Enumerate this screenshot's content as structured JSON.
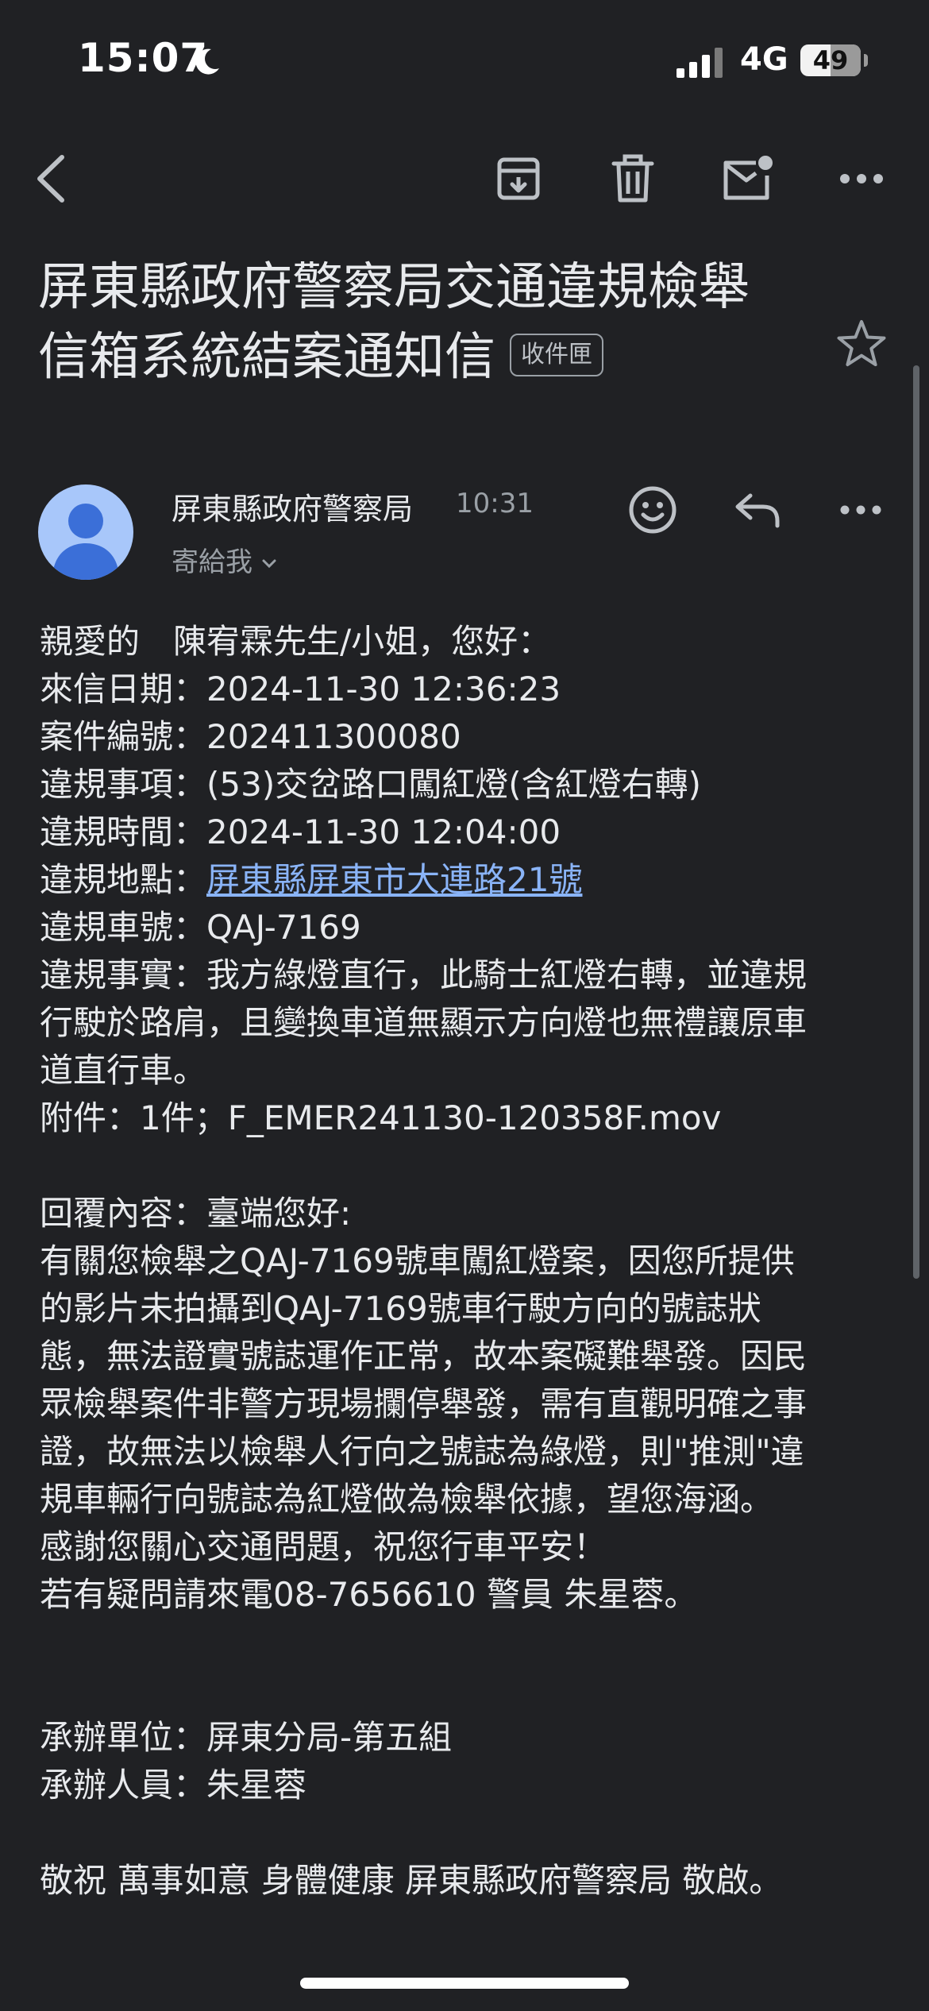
{
  "status_bar": {
    "time": "15:07",
    "network": "4G",
    "battery": "49"
  },
  "email": {
    "subject_line1": "屏東縣政府警察局交通違規檢舉",
    "subject_line2": "信箱系統結案通知信",
    "label": "收件匣",
    "sender": "屏東縣政府警察局",
    "time": "10:31",
    "recipient": "寄給我",
    "body": {
      "greeting": "親愛的　陳宥霖先生/小姐，您好：",
      "date": "來信日期：2024-11-30 12:36:23",
      "case_no": "案件編號：202411300080",
      "item": "違規事項：(53)交岔路口闖紅燈(含紅燈右轉)",
      "violation_time": "違規時間：2024-11-30 12:04:00",
      "location_label": "違規地點：",
      "location_link": "屏東縣屏東市大連路21號",
      "plate": "違規車號：QAJ-7169",
      "facts_1": "違規事實：我方綠燈直行，此騎士紅燈右轉，並違規",
      "facts_2": "行駛於路肩，且變換車道無顯示方向燈也無禮讓原車",
      "facts_3": "道直行車。",
      "attachment": "附件：1件；F_EMER241130-120358F.mov",
      "reply_header": "回覆內容：臺端您好:",
      "reply_1": "有關您檢舉之QAJ-7169號車闖紅燈案，因您所提供",
      "reply_2": "的影片未拍攝到QAJ-7169號車行駛方向的號誌狀",
      "reply_3": "態，無法證實號誌運作正常，故本案礙難舉發。因民",
      "reply_4": "眾檢舉案件非警方現場攔停舉發，需有直觀明確之事",
      "reply_5": "證，故無法以檢舉人行向之號誌為綠燈，則\"推測\"違",
      "reply_6": "規車輛行向號誌為紅燈做為檢舉依據，望您海涵。",
      "reply_7": "感謝您關心交通問題，祝您行車平安！",
      "reply_8": "若有疑問請來電08-7656610 警員 朱星蓉。",
      "unit": "承辦單位：屏東分局-第五組",
      "officer": "承辦人員：朱星蓉",
      "closing": "敬祝 萬事如意 身體健康 屏東縣政府警察局 敬啟。"
    }
  },
  "colors": {
    "background": "#202124",
    "text": "#e8eaed",
    "secondary": "#9aa0a6",
    "link": "#8ab4f8",
    "avatar": "#a8c7fa"
  }
}
